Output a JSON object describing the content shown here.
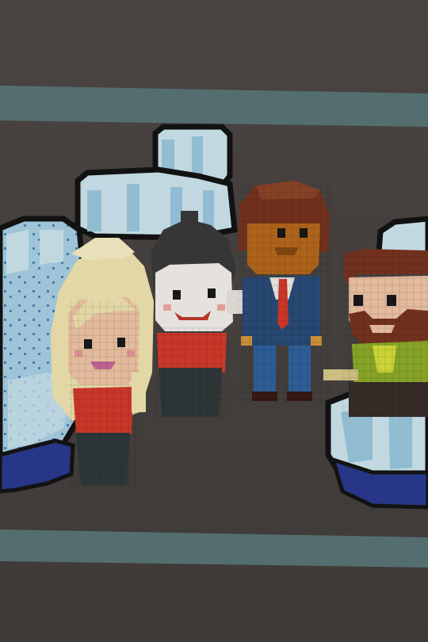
{
  "scene": {
    "description_free": true,
    "colors": {
      "wall_top": "#4e4946",
      "wall_bottom": "#433e3b",
      "stripe": "#5a7577",
      "cloud_light": "#cfe6ef",
      "cloud_mid": "#9cc8e0",
      "cloud_shadow": "#4f7fa6",
      "cloud_outline": "#141414",
      "cloud_base": "#2a3a8f",
      "skin_light": "#f2c7a6",
      "skin_dark": "#b86a1c",
      "hair_blonde": "#f2e6b0",
      "hair_dark": "#3a3a3a",
      "hair_brown": "#7a3520",
      "shirt_red": "#d63b2c",
      "suit_blue": "#2a4d7a",
      "jacket_green": "#8fae2a",
      "pants_dark": "#2f3a3a"
    }
  },
  "characters": [
    {
      "id": "blonde-girl",
      "icon": "pixel-character-blonde"
    },
    {
      "id": "dark-haired-girl",
      "icon": "pixel-character-dark-hair"
    },
    {
      "id": "man-in-suit",
      "icon": "pixel-character-suit"
    },
    {
      "id": "bearded-man",
      "icon": "pixel-character-beard"
    }
  ]
}
